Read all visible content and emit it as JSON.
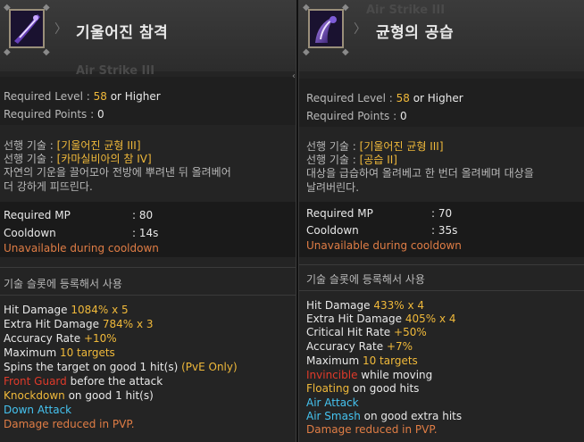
{
  "left": {
    "ghost_title": "Air Strike III",
    "title": "기울어진 참격",
    "required_level_label": "Required Level",
    "required_level_value": "58",
    "required_level_suffix": "or Higher",
    "required_points_label": "Required Points",
    "required_points_value": "0",
    "prereq_label": "선행 기술 : ",
    "prereq_1": "[기울어진 균형 III]",
    "prereq_2": "[카마실비아의 참 IV]",
    "description_1": "자연의 기운을 끌어모아 전방에 뿌려낸 뒤 올려베어",
    "description_2": "더 강하게 피뜨린다.",
    "mp_label": "Required MP",
    "mp_value": ": 80",
    "cooldown_label": "Cooldown",
    "cooldown_value": ": 14s",
    "unavailable": "Unavailable during cooldown",
    "section": "기술 슬롯에 등록해서 사용",
    "stats": {
      "hit_damage_label": "Hit Damage",
      "hit_damage_value": "1084% x 5",
      "extra_hit_label": "Extra Hit Damage",
      "extra_hit_value": "784% x 3",
      "accuracy_label": "Accuracy Rate",
      "accuracy_value": "+10%",
      "maximum_label": "Maximum",
      "maximum_value": "10 targets",
      "spins_text": "Spins the target on good 1 hit(s)",
      "spins_pve": "(PvE Only)",
      "front_guard": "Front Guard",
      "front_guard_suffix": "before the attack",
      "knockdown": "Knockdown",
      "knockdown_suffix": "on good 1 hit(s)",
      "down_attack": "Down Attack",
      "pvp": "Damage reduced in PVP."
    }
  },
  "right": {
    "ghost_title": "Air Strike III",
    "title": "균형의 공습",
    "required_level_label": "Required Level",
    "required_level_value": "58",
    "required_level_suffix": "or Higher",
    "required_points_label": "Required Points",
    "required_points_value": "0",
    "prereq_label": "선행 기술 : ",
    "prereq_1": "[기울어진 균형 III]",
    "prereq_2": "[공습 II]",
    "description_1": "대상을 급습하여 올려베고 한 번더 올려베며 대상을",
    "description_2": "날려버린다.",
    "mp_label": "Required MP",
    "mp_value": ": 70",
    "cooldown_label": "Cooldown",
    "cooldown_value": ": 35s",
    "unavailable": "Unavailable during cooldown",
    "section": "기술 슬롯에 등록해서 사용",
    "stats": {
      "hit_damage_label": "Hit Damage",
      "hit_damage_value": "433% x 4",
      "extra_hit_label": "Extra Hit Damage",
      "extra_hit_value": "405% x 4",
      "critical_label": "Critical Hit Rate",
      "critical_value": "+50%",
      "accuracy_label": "Accuracy Rate",
      "accuracy_value": "+7%",
      "maximum_label": "Maximum",
      "maximum_value": "10 targets",
      "invincible": "Invincible",
      "invincible_suffix": "while moving",
      "floating": "Floating",
      "floating_suffix": "on good hits",
      "air_attack": "Air Attack",
      "air_smash": "Air Smash",
      "air_smash_suffix": "on good extra hits",
      "pvp": "Damage reduced in PVP."
    }
  },
  "colors": {
    "yellow": "#f0b93a",
    "red": "#e03a2a",
    "orange": "#e07d45",
    "cyan": "#45c3f0"
  },
  "icons": {
    "left_icon": "slash-skill-icon",
    "right_icon": "air-strike-skill-icon"
  }
}
